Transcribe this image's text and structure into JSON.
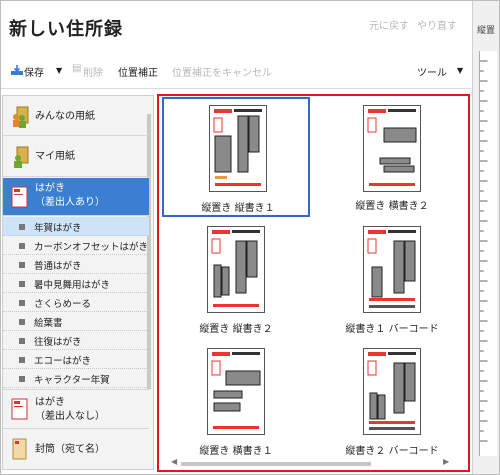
{
  "app": {
    "title": "新しい住所録",
    "undo": "元に戻す",
    "redo": "やり直す"
  },
  "toolbar": {
    "save_label": "保存",
    "delete_label": "削除",
    "position_label": "位置補正",
    "cancel_position_label": "位置補正をキャンセル",
    "tools_label": "ツール"
  },
  "sidebar": {
    "categories": [
      {
        "label": "みんなの用紙"
      },
      {
        "label": "マイ用紙"
      },
      {
        "label": "はがき\n（差出人あり）"
      },
      {
        "label": "はがき\n（差出人なし）"
      },
      {
        "label": "封筒（宛て名）"
      }
    ],
    "subitems": [
      "年賀はがき",
      "カーボンオフセットはがき",
      "普通はがき",
      "暑中見舞用はがき",
      "さくらめーる",
      "絵葉書",
      "往復はがき",
      "エコーはがき",
      "キャラクター年賀"
    ]
  },
  "layouts": [
    {
      "label": "縦置き 縦書き１"
    },
    {
      "label": "縦置き 横書き２"
    },
    {
      "label": "縦置き 縦書き２"
    },
    {
      "label": "縦書き１ バーコード"
    },
    {
      "label": "縦置き 横書き１"
    },
    {
      "label": "縦書き２ バーコード"
    }
  ],
  "right_panel": {
    "label": "縦置"
  },
  "colors": {
    "accent": "#3b7fd0",
    "highlight_border": "#e8141b",
    "selected_border": "#3466c6"
  }
}
